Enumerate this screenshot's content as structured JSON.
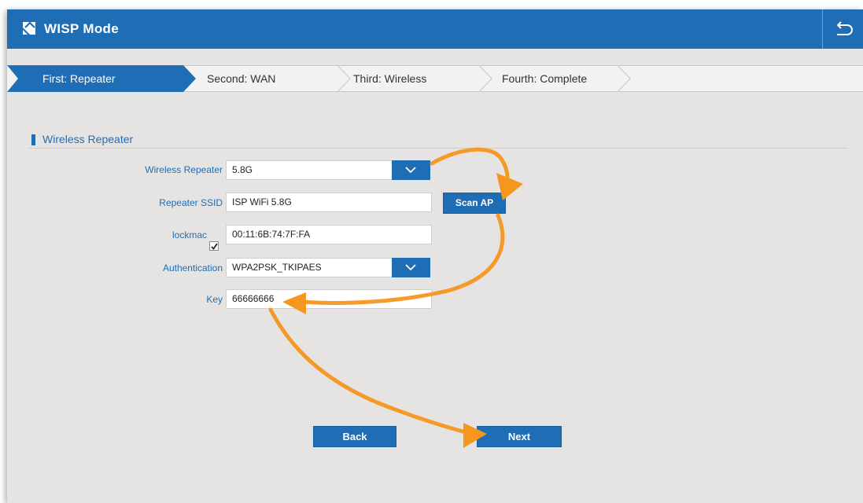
{
  "header": {
    "title": "WISP Mode"
  },
  "steps": [
    {
      "label": "First: Repeater",
      "active": true
    },
    {
      "label": "Second: WAN",
      "active": false
    },
    {
      "label": "Third: Wireless",
      "active": false
    },
    {
      "label": "Fourth: Complete",
      "active": false
    }
  ],
  "section": {
    "title": "Wireless Repeater"
  },
  "form": {
    "band_label": "Wireless Repeater",
    "band_value": "5.8G",
    "ssid_label": "Repeater SSID",
    "ssid_value": "ISP WiFi 5.8G",
    "scan_label": "Scan AP",
    "lockmac_label": "lockmac",
    "lockmac_checked": true,
    "lockmac_value": "00:11:6B:74:7F:FA",
    "auth_label": "Authentication",
    "auth_value": "WPA2PSK_TKIPAES",
    "key_label": "Key",
    "key_value": "66666666"
  },
  "buttons": {
    "back": "Back",
    "next": "Next"
  },
  "colors": {
    "primary": "#1f6db5",
    "background": "#e6e4e3",
    "annotation": "#f5961e"
  }
}
